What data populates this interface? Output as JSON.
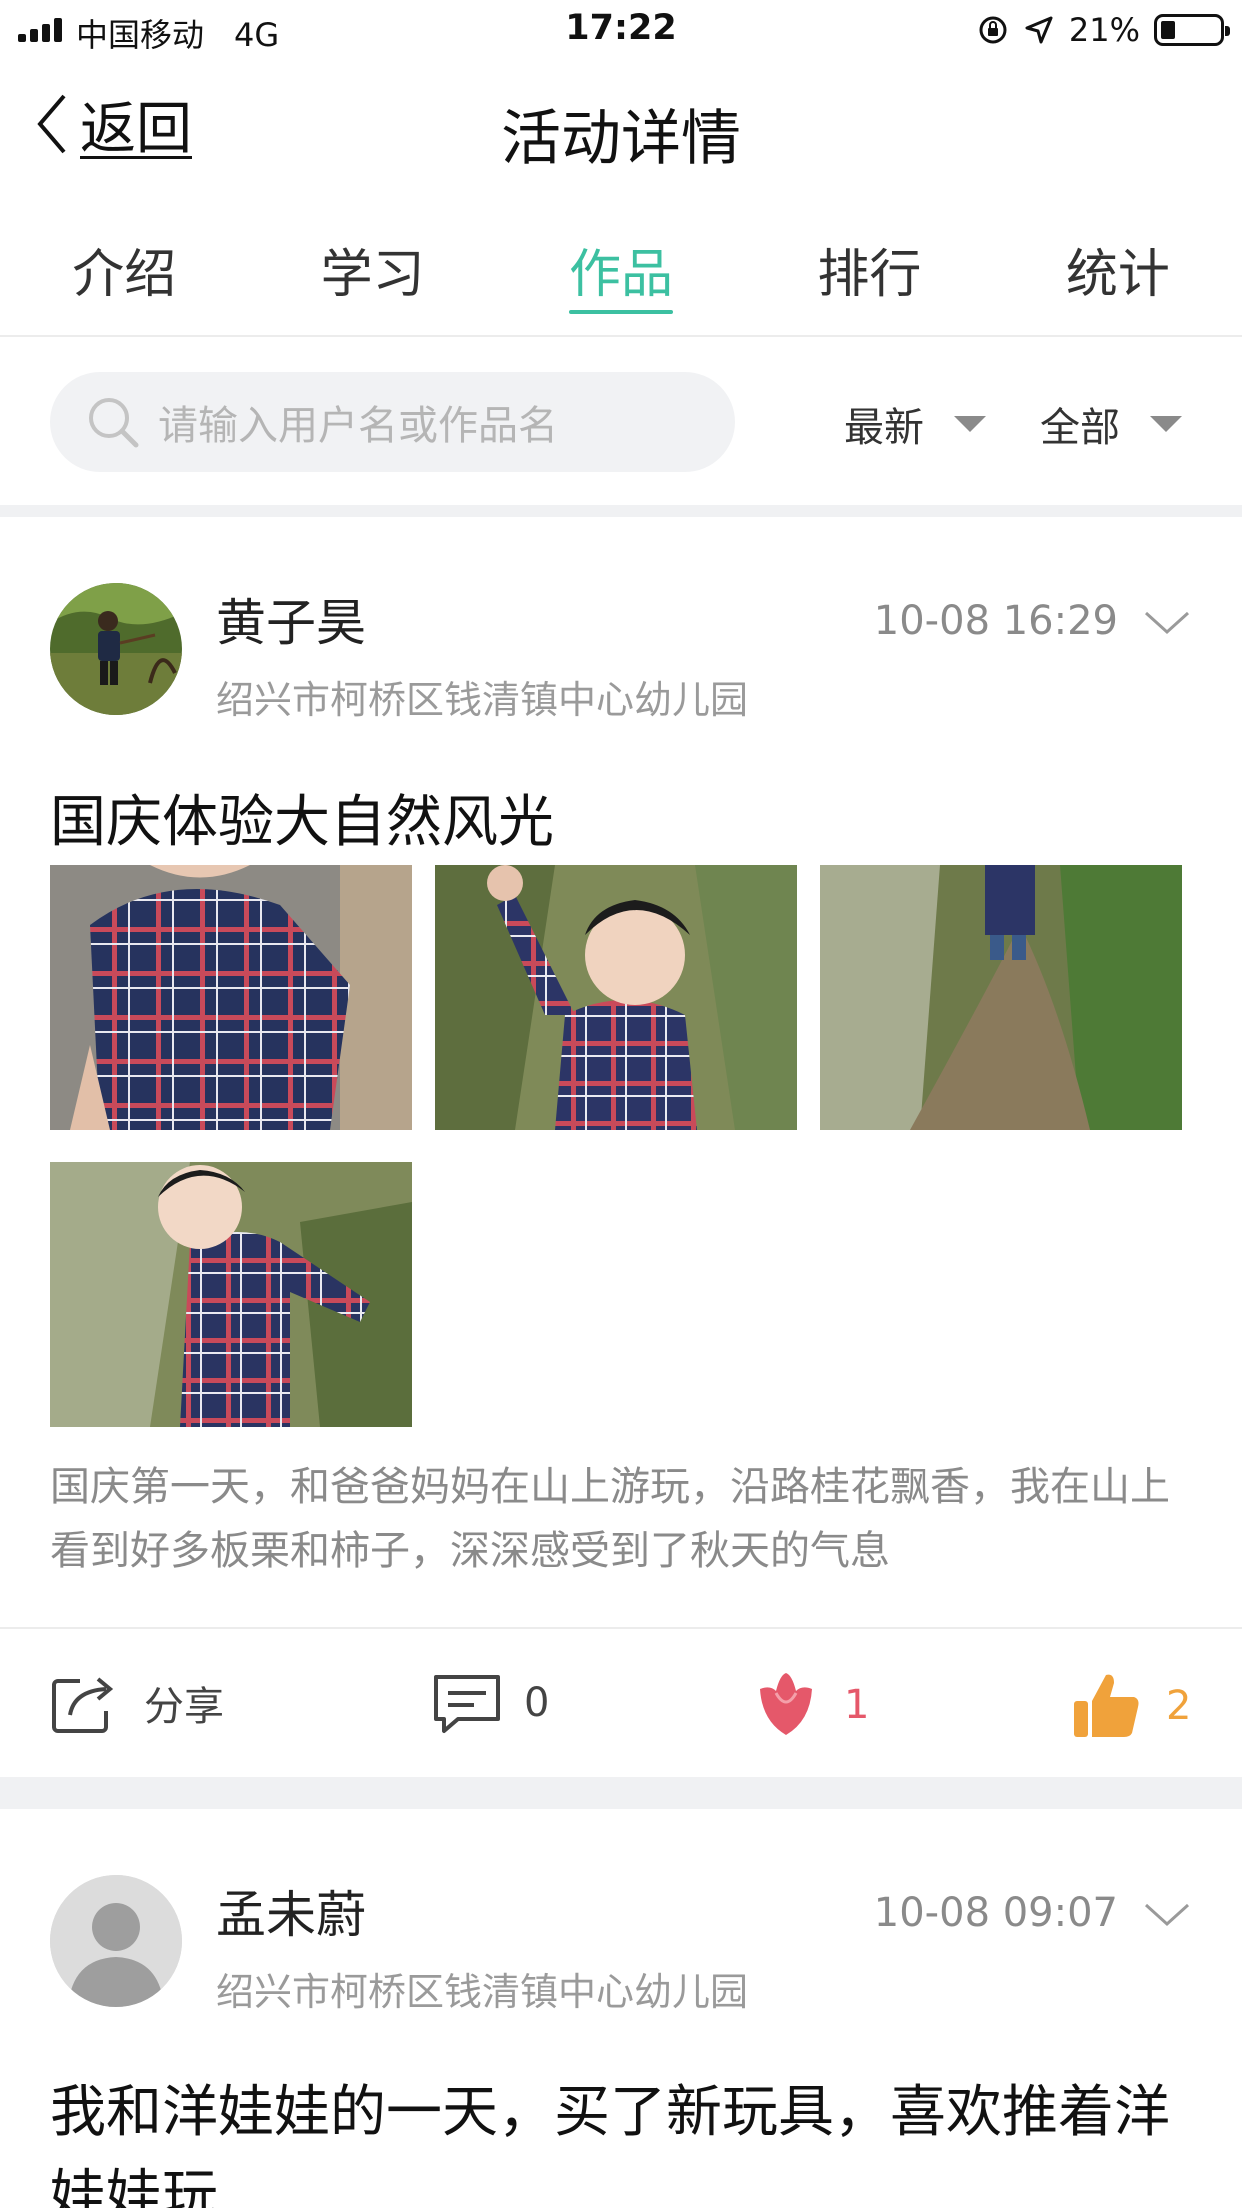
{
  "status_bar": {
    "carrier": "中国移动",
    "network": "4G",
    "time": "17:22",
    "battery": "21%"
  },
  "nav": {
    "back_label": "返回",
    "title": "活动详情"
  },
  "tabs": [
    {
      "label": "介绍",
      "active": false
    },
    {
      "label": "学习",
      "active": false
    },
    {
      "label": "作品",
      "active": true
    },
    {
      "label": "排行",
      "active": false
    },
    {
      "label": "统计",
      "active": false
    }
  ],
  "search": {
    "placeholder": "请输入用户名或作品名",
    "sort_label": "最新",
    "filter_label": "全部"
  },
  "posts": [
    {
      "author": "黄子昊",
      "school": "绍兴市柯桥区钱清镇中心幼儿园",
      "time": "10-08 16:29",
      "title": "国庆体验大自然风光",
      "photo_count": 4,
      "description": "国庆第一天，和爸爸妈妈在山上游玩，沿路桂花飘香，我在山上看到好多板栗和柿子，深深感受到了秋天的气息",
      "share_label": "分享",
      "comments": "0",
      "flowers": "1",
      "likes": "2"
    },
    {
      "author": "孟未蔚",
      "school": "绍兴市柯桥区钱清镇中心幼儿园",
      "time": "10-08 09:07",
      "title": "我和洋娃娃的一天，买了新玩具，喜欢推着洋娃娃玩"
    }
  ],
  "colors": {
    "accent": "#3cc0a1",
    "flower": "#e5586a",
    "like": "#f0a23b",
    "muted": "#8a8a8a"
  }
}
